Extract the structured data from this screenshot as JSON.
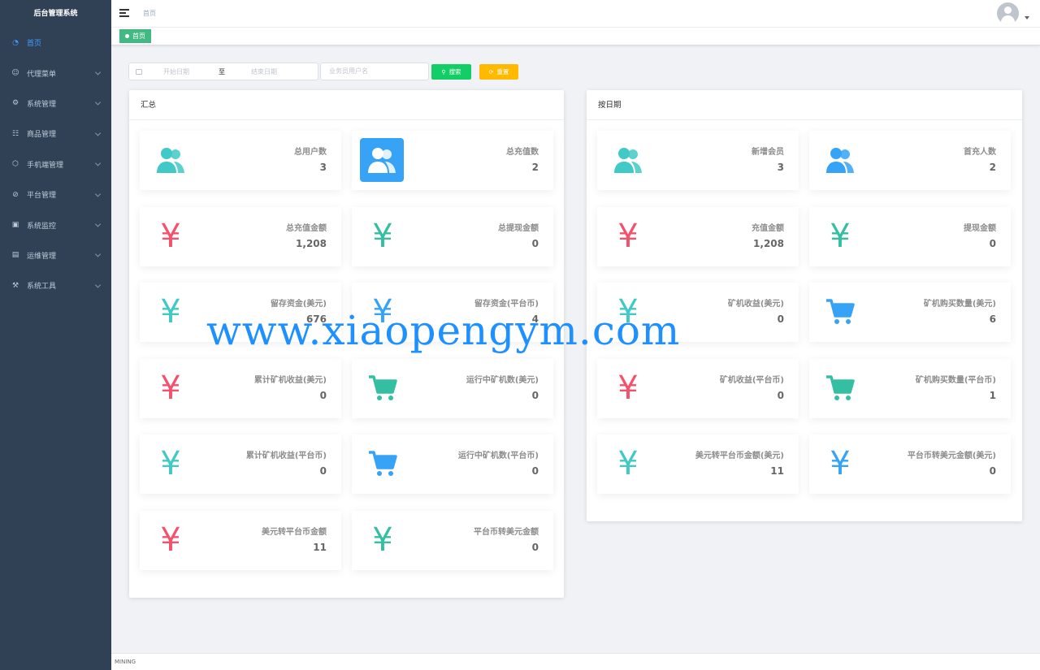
{
  "app": {
    "title": "后台管理系统"
  },
  "sidebar": {
    "items": [
      {
        "label": "首页",
        "icon": "dashboard-icon",
        "active": true,
        "arrow": false
      },
      {
        "label": "代理菜单",
        "icon": "agent-icon",
        "arrow": true
      },
      {
        "label": "系统管理",
        "icon": "gear-icon",
        "arrow": true
      },
      {
        "label": "商品管理",
        "icon": "cart-icon",
        "arrow": true
      },
      {
        "label": "手机端管理",
        "icon": "cube-icon",
        "arrow": true
      },
      {
        "label": "平台管理",
        "icon": "tool-icon",
        "arrow": true
      },
      {
        "label": "系统监控",
        "icon": "monitor-icon",
        "arrow": true
      },
      {
        "label": "运维管理",
        "icon": "server-icon",
        "arrow": true
      },
      {
        "label": "系统工具",
        "icon": "tools-icon",
        "arrow": true
      }
    ]
  },
  "navbar": {
    "breadcrumb": "首页"
  },
  "tags": {
    "active": "首页"
  },
  "filters": {
    "start_placeholder": "开始日期",
    "range_separator": "至",
    "end_placeholder": "结束日期",
    "user_placeholder": "业务员用户名",
    "search_label": "搜索",
    "reset_label": "重置"
  },
  "summary": {
    "title": "汇总",
    "cards": [
      {
        "label": "总用户数",
        "value": "3",
        "icon": "users-icon",
        "color": "#40c9c6"
      },
      {
        "label": "总充值数",
        "value": "2",
        "icon": "users-icon",
        "color": "#ffffff",
        "boxed": true
      },
      {
        "label": "总充值金额",
        "value": "1,208",
        "icon": "yen-icon",
        "color": "#f4516c"
      },
      {
        "label": "总提现金额",
        "value": "0",
        "icon": "yen-icon",
        "color": "#34bfa3"
      },
      {
        "label": "留存资金(美元)",
        "value": "676",
        "icon": "yen-icon",
        "color": "#40c9c6"
      },
      {
        "label": "留存资金(平台币)",
        "value": "4",
        "icon": "yen-icon",
        "color": "#36a3f7"
      },
      {
        "label": "累计矿机收益(美元)",
        "value": "0",
        "icon": "yen-icon",
        "color": "#f4516c"
      },
      {
        "label": "运行中矿机数(美元)",
        "value": "0",
        "icon": "cart-icon",
        "color": "#34bfa3"
      },
      {
        "label": "累计矿机收益(平台币)",
        "value": "0",
        "icon": "yen-icon",
        "color": "#40c9c6"
      },
      {
        "label": "运行中矿机数(平台币)",
        "value": "0",
        "icon": "cart-icon",
        "color": "#36a3f7"
      },
      {
        "label": "美元转平台币金额",
        "value": "11",
        "icon": "yen-icon",
        "color": "#f4516c"
      },
      {
        "label": "平台币转美元金额",
        "value": "0",
        "icon": "yen-icon",
        "color": "#34bfa3"
      }
    ]
  },
  "by_date": {
    "title": "按日期",
    "cards": [
      {
        "label": "新增会员",
        "value": "3",
        "icon": "users-icon",
        "color": "#40c9c6"
      },
      {
        "label": "首充人数",
        "value": "2",
        "icon": "users-icon",
        "color": "#36a3f7"
      },
      {
        "label": "充值金额",
        "value": "1,208",
        "icon": "yen-icon",
        "color": "#f4516c"
      },
      {
        "label": "提现金额",
        "value": "0",
        "icon": "yen-icon",
        "color": "#34bfa3"
      },
      {
        "label": "矿机收益(美元)",
        "value": "0",
        "icon": "yen-icon",
        "color": "#40c9c6"
      },
      {
        "label": "矿机购买数量(美元)",
        "value": "6",
        "icon": "cart-icon",
        "color": "#36a3f7"
      },
      {
        "label": "矿机收益(平台币)",
        "value": "0",
        "icon": "yen-icon",
        "color": "#f4516c"
      },
      {
        "label": "矿机购买数量(平台币)",
        "value": "1",
        "icon": "cart-icon",
        "color": "#34bfa3"
      },
      {
        "label": "美元转平台币金额(美元)",
        "value": "11",
        "icon": "yen-icon",
        "color": "#40c9c6"
      },
      {
        "label": "平台币转美元金额(美元)",
        "value": "0",
        "icon": "yen-icon",
        "color": "#36a3f7"
      }
    ]
  },
  "watermark": "www.xiaopengym.com",
  "footer": {
    "text": "MINING"
  }
}
